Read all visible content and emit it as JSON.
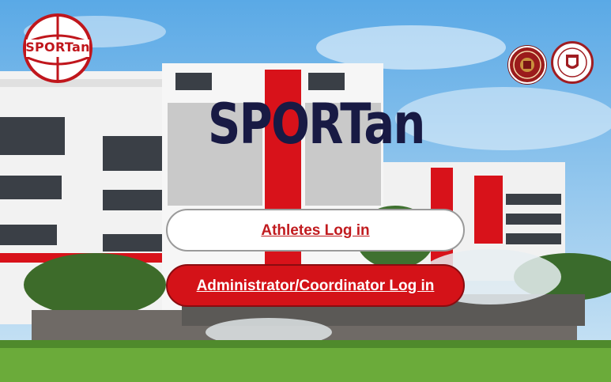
{
  "app": {
    "title": "SPORTan",
    "logo_text": "SPORTan"
  },
  "login": {
    "athletes_label": "Athletes  Log in",
    "admin_label": "Administrator/Coordinator Log in"
  },
  "icons": {
    "brand_logo": "basketball-logo-icon",
    "seal_left": "university-seal-icon",
    "seal_right": "college-crest-icon"
  },
  "colors": {
    "brand_red": "#d41218",
    "title_navy": "#181a44",
    "sky_blue": "#6fb6e6"
  }
}
